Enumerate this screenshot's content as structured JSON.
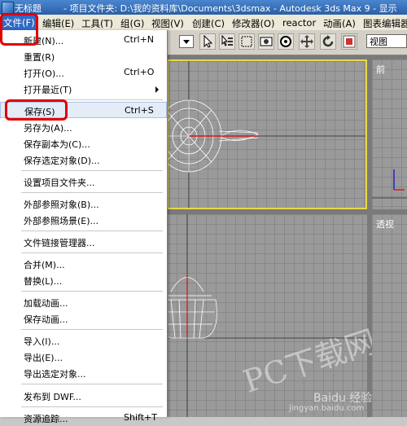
{
  "titlebar": {
    "doc_title": "无标题",
    "app_title": "- 项目文件夹: D:\\我的资料库\\Documents\\3dsmax     - Autodesk 3ds Max 9     - 显示"
  },
  "menubar": [
    {
      "label": "文件(F)"
    },
    {
      "label": "编辑(E)"
    },
    {
      "label": "工具(T)"
    },
    {
      "label": "组(G)"
    },
    {
      "label": "视图(V)"
    },
    {
      "label": "创建(C)"
    },
    {
      "label": "修改器(O)"
    },
    {
      "label": "reactor"
    },
    {
      "label": "动画(A)"
    },
    {
      "label": "图表编辑器"
    }
  ],
  "toolbar": {
    "view_select": "视图"
  },
  "viewports": {
    "top_right_label": "前",
    "bottom_right_label": "透视"
  },
  "file_menu": {
    "items": [
      {
        "label": "新建(N)...",
        "shortcut": "Ctrl+N"
      },
      {
        "label": "重置(R)",
        "shortcut": ""
      },
      {
        "label": "打开(O)...",
        "shortcut": "Ctrl+O"
      },
      {
        "label": "打开最近(T)",
        "shortcut": ""
      },
      {
        "label": "保存(S)",
        "shortcut": "Ctrl+S"
      },
      {
        "label": "另存为(A)...",
        "shortcut": ""
      },
      {
        "label": "保存副本为(C)...",
        "shortcut": ""
      },
      {
        "label": "保存选定对象(D)...",
        "shortcut": ""
      },
      {
        "label": "设置项目文件夹...",
        "shortcut": ""
      },
      {
        "label": "外部参照对象(B)...",
        "shortcut": ""
      },
      {
        "label": "外部参照场景(E)...",
        "shortcut": ""
      },
      {
        "label": "文件链接管理器...",
        "shortcut": ""
      },
      {
        "label": "合并(M)...",
        "shortcut": ""
      },
      {
        "label": "替换(L)...",
        "shortcut": ""
      },
      {
        "label": "加载动画...",
        "shortcut": ""
      },
      {
        "label": "保存动画...",
        "shortcut": ""
      },
      {
        "label": "导入(I)...",
        "shortcut": ""
      },
      {
        "label": "导出(E)...",
        "shortcut": ""
      },
      {
        "label": "导出选定对象...",
        "shortcut": ""
      },
      {
        "label": "发布到 DWF...",
        "shortcut": ""
      },
      {
        "label": "资源追踪...",
        "shortcut": "Shift+T"
      }
    ]
  },
  "watermark": {
    "text": "PC下载网",
    "baidu": "Baidu 经验",
    "url": "jingyan.baidu.com"
  },
  "colors": {
    "highlight_red": "#e10000",
    "active_viewport_border": "#e6d84a",
    "menu_active": "#316ac5"
  }
}
